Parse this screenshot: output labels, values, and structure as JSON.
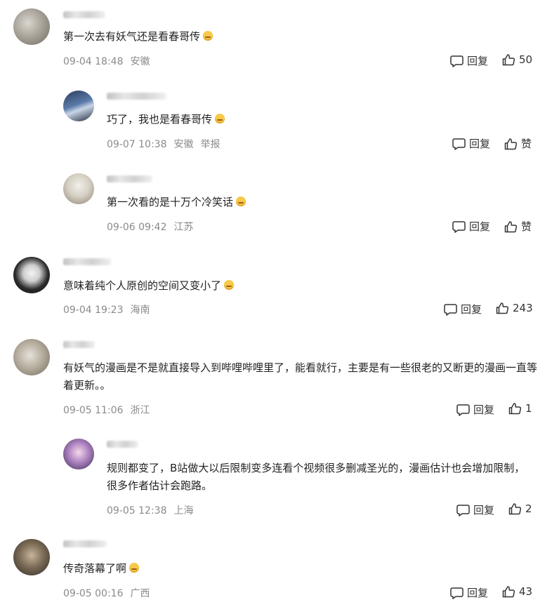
{
  "actions": {
    "reply": "回复",
    "like_default": "赞"
  },
  "comments": [
    {
      "text": "第一次去有妖气还是看春哥传",
      "time": "09-04 18:48",
      "location": "安徽",
      "likes": "50"
    },
    {
      "text": "巧了，我也是看春哥传",
      "time": "09-07 10:38",
      "location": "安徽",
      "report": "举报",
      "likes": "赞"
    },
    {
      "text": "第一次看的是十万个冷笑话",
      "time": "09-06 09:42",
      "location": "江苏",
      "likes": "赞"
    },
    {
      "text": "意味着纯个人原创的空间又变小了",
      "time": "09-04 19:23",
      "location": "海南",
      "likes": "243"
    },
    {
      "text": "有妖气的漫画是不是就直接导入到哔哩哔哩里了，能看就行，主要是有一些很老的又断更的漫画一直等着更新。。",
      "time": "09-05 11:06",
      "location": "浙江",
      "likes": "1"
    },
    {
      "text": "规则都变了，B站做大以后限制变多连看个视频很多删减圣光的，漫画估计也会增加限制，很多作者估计会跑路。",
      "time": "09-05 12:38",
      "location": "上海",
      "likes": "2"
    },
    {
      "text": "传奇落幕了啊",
      "time": "09-05 00:16",
      "location": "广西",
      "likes": "43"
    }
  ]
}
